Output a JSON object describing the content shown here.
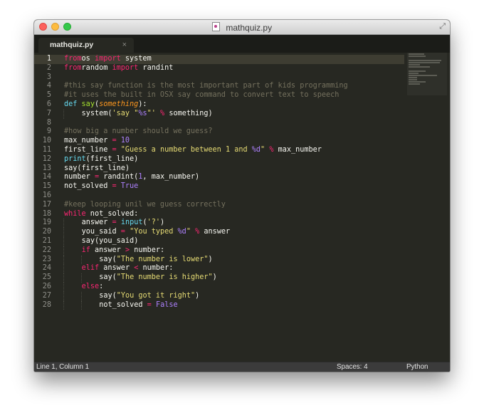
{
  "window": {
    "title": "mathquiz.py"
  },
  "tab": {
    "label": "mathquiz.py",
    "close": "×"
  },
  "colors": {
    "background": "#272822",
    "keyword": "#f92672",
    "string": "#e6db74",
    "comment": "#75715e",
    "number": "#ae81ff",
    "function": "#a6e22e",
    "builtin": "#66d9ef",
    "parameter": "#fd971f"
  },
  "icons": [
    "close-traffic-light",
    "minimize-traffic-light",
    "zoom-traffic-light",
    "python-file-icon",
    "fullscreen-icon",
    "tab-close-icon"
  ],
  "editor": {
    "current_line": 1,
    "lines": [
      {
        "n": "1",
        "indent": 0,
        "tokens": [
          [
            "kw",
            "from"
          ],
          [
            "",
            "os "
          ],
          [
            "kw",
            "import"
          ],
          [
            "",
            " system"
          ]
        ]
      },
      {
        "n": "2",
        "indent": 0,
        "tokens": [
          [
            "kw",
            "from"
          ],
          [
            "",
            "random "
          ],
          [
            "kw",
            "import"
          ],
          [
            "",
            " randint"
          ]
        ]
      },
      {
        "n": "3",
        "indent": 0,
        "tokens": []
      },
      {
        "n": "4",
        "indent": 0,
        "tokens": [
          [
            "com",
            "#this say function is the most important part of kids programming"
          ]
        ]
      },
      {
        "n": "5",
        "indent": 0,
        "tokens": [
          [
            "com",
            "#it uses the built in OSX say command to convert text to speech"
          ]
        ]
      },
      {
        "n": "6",
        "indent": 0,
        "tokens": [
          [
            "bi",
            "def"
          ],
          [
            "",
            " "
          ],
          [
            "fn",
            "say"
          ],
          [
            "",
            "("
          ],
          [
            "it",
            "something"
          ],
          [
            "",
            "):"
          ]
        ]
      },
      {
        "n": "7",
        "indent": 1,
        "tokens": [
          [
            "",
            "system("
          ],
          [
            "str",
            "'say \""
          ],
          [
            "num",
            "%s"
          ],
          [
            "str",
            "\"'"
          ],
          [
            "",
            " "
          ],
          [
            "kw",
            "%"
          ],
          [
            "",
            " something)"
          ]
        ]
      },
      {
        "n": "8",
        "indent": 0,
        "tokens": []
      },
      {
        "n": "9",
        "indent": 0,
        "tokens": [
          [
            "com",
            "#how big a number should we guess?"
          ]
        ]
      },
      {
        "n": "10",
        "indent": 0,
        "tokens": [
          [
            "",
            "max_number "
          ],
          [
            "kw",
            "="
          ],
          [
            "",
            " "
          ],
          [
            "num",
            "10"
          ]
        ]
      },
      {
        "n": "11",
        "indent": 0,
        "tokens": [
          [
            "",
            "first_line "
          ],
          [
            "kw",
            "="
          ],
          [
            "",
            " "
          ],
          [
            "str",
            "\"Guess a number between 1 and "
          ],
          [
            "num",
            "%d"
          ],
          [
            "str",
            "\""
          ],
          [
            "",
            " "
          ],
          [
            "kw",
            "%"
          ],
          [
            "",
            " max_number"
          ]
        ]
      },
      {
        "n": "12",
        "indent": 0,
        "tokens": [
          [
            "bi",
            "print"
          ],
          [
            "",
            "(first_line)"
          ]
        ]
      },
      {
        "n": "13",
        "indent": 0,
        "tokens": [
          [
            "",
            "say(first_line)"
          ]
        ]
      },
      {
        "n": "14",
        "indent": 0,
        "tokens": [
          [
            "",
            "number "
          ],
          [
            "kw",
            "="
          ],
          [
            "",
            " randint("
          ],
          [
            "num",
            "1"
          ],
          [
            "",
            ", max_number)"
          ]
        ]
      },
      {
        "n": "15",
        "indent": 0,
        "tokens": [
          [
            "",
            "not_solved "
          ],
          [
            "kw",
            "="
          ],
          [
            "",
            " "
          ],
          [
            "num",
            "True"
          ]
        ]
      },
      {
        "n": "16",
        "indent": 0,
        "tokens": []
      },
      {
        "n": "17",
        "indent": 0,
        "tokens": [
          [
            "com",
            "#keep looping unil we guess correctly"
          ]
        ]
      },
      {
        "n": "18",
        "indent": 0,
        "tokens": [
          [
            "kw",
            "while"
          ],
          [
            "",
            " not_solved:"
          ]
        ]
      },
      {
        "n": "19",
        "indent": 1,
        "tokens": [
          [
            "",
            "answer "
          ],
          [
            "kw",
            "="
          ],
          [
            "",
            " "
          ],
          [
            "bi",
            "input"
          ],
          [
            "",
            "("
          ],
          [
            "str",
            "'?'"
          ],
          [
            "",
            ")"
          ]
        ]
      },
      {
        "n": "20",
        "indent": 1,
        "tokens": [
          [
            "",
            "you_said "
          ],
          [
            "kw",
            "="
          ],
          [
            "",
            " "
          ],
          [
            "str",
            "\"You typed "
          ],
          [
            "num",
            "%d"
          ],
          [
            "str",
            "\""
          ],
          [
            "",
            " "
          ],
          [
            "kw",
            "%"
          ],
          [
            "",
            " answer"
          ]
        ]
      },
      {
        "n": "21",
        "indent": 1,
        "tokens": [
          [
            "",
            "say(you_said)"
          ]
        ]
      },
      {
        "n": "22",
        "indent": 1,
        "tokens": [
          [
            "kw",
            "if"
          ],
          [
            "",
            " answer "
          ],
          [
            "kw",
            ">"
          ],
          [
            "",
            " number:"
          ]
        ]
      },
      {
        "n": "23",
        "indent": 2,
        "tokens": [
          [
            "",
            "say("
          ],
          [
            "str",
            "\"The number is lower\""
          ],
          [
            "",
            ")"
          ]
        ]
      },
      {
        "n": "24",
        "indent": 1,
        "tokens": [
          [
            "kw",
            "elif"
          ],
          [
            "",
            " answer "
          ],
          [
            "kw",
            "<"
          ],
          [
            "",
            " number:"
          ]
        ]
      },
      {
        "n": "25",
        "indent": 2,
        "tokens": [
          [
            "",
            "say("
          ],
          [
            "str",
            "\"The number is higher\""
          ],
          [
            "",
            ")"
          ]
        ]
      },
      {
        "n": "26",
        "indent": 1,
        "tokens": [
          [
            "kw",
            "else"
          ],
          [
            "",
            ":"
          ]
        ]
      },
      {
        "n": "27",
        "indent": 2,
        "tokens": [
          [
            "",
            "say("
          ],
          [
            "str",
            "\"You got it right\""
          ],
          [
            "",
            ")"
          ]
        ]
      },
      {
        "n": "28",
        "indent": 2,
        "tokens": [
          [
            "",
            "not_solved "
          ],
          [
            "kw",
            "="
          ],
          [
            "",
            " "
          ],
          [
            "num",
            "False"
          ]
        ]
      }
    ]
  },
  "status": {
    "position": "Line 1, Column 1",
    "indentation": "Spaces: 4",
    "syntax": "Python"
  }
}
